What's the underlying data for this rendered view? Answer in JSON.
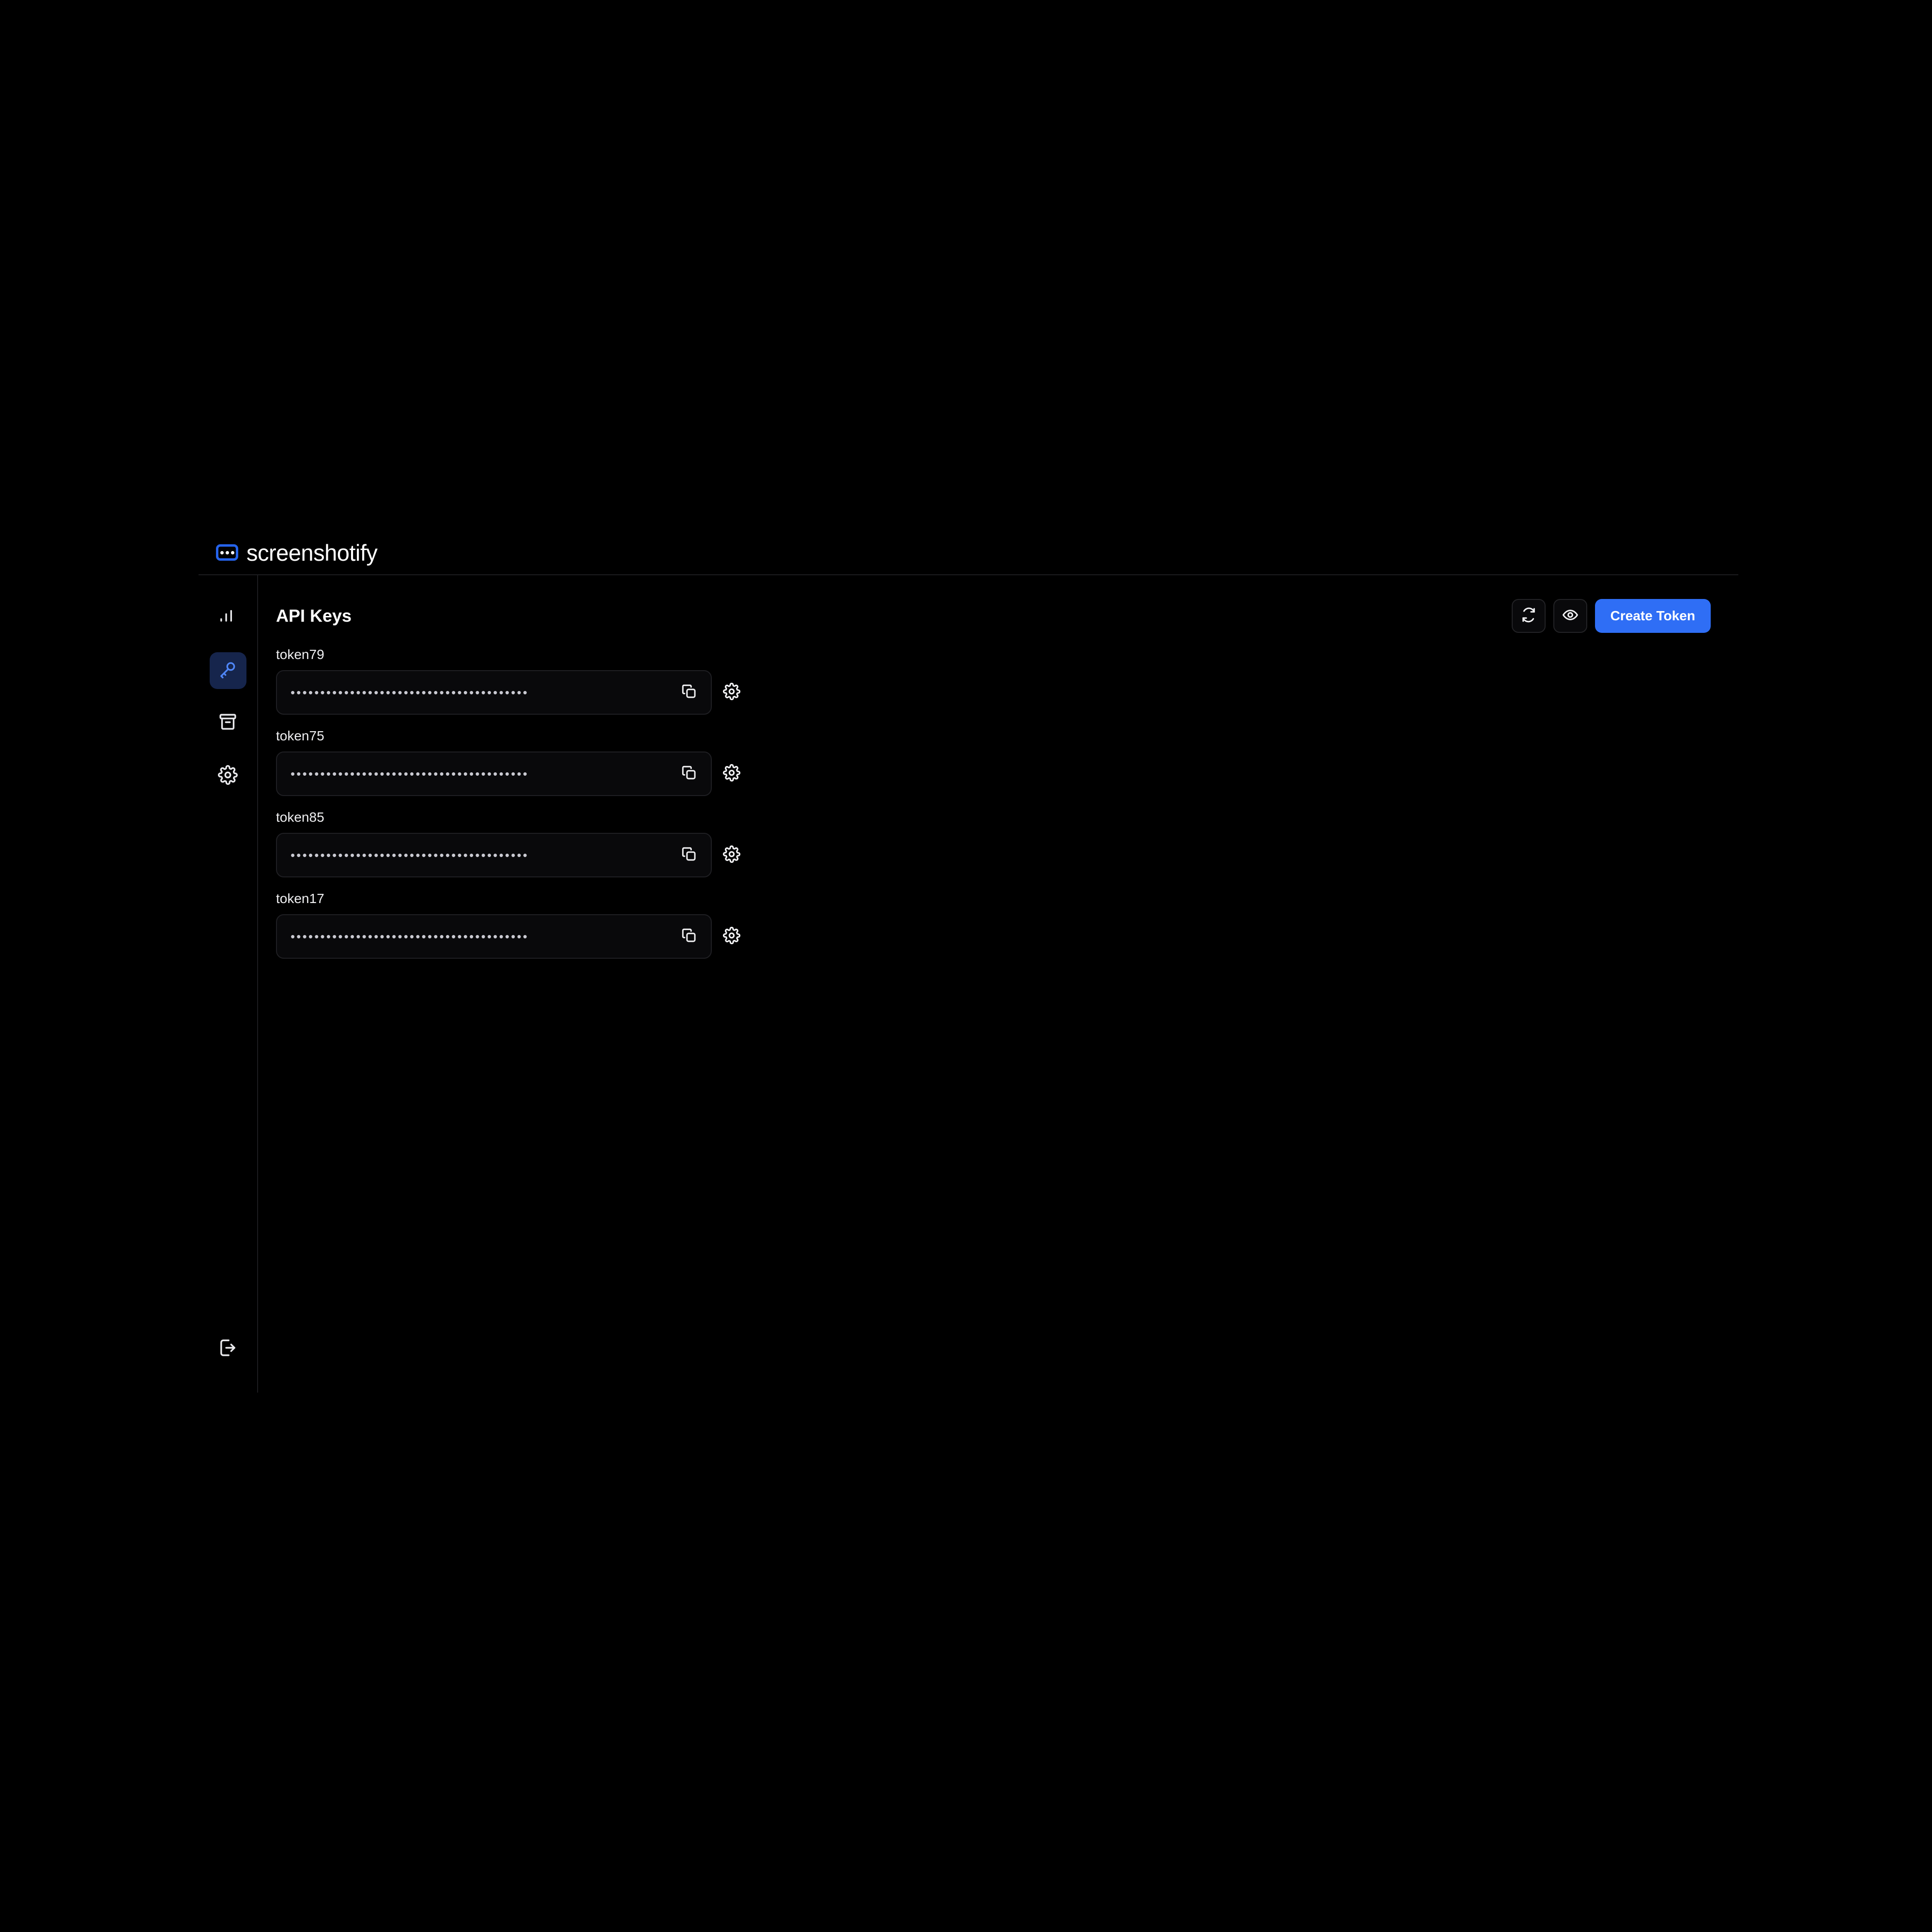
{
  "brand": {
    "name": "screenshotify",
    "logo_icon": "dots-badge-icon"
  },
  "sidebar": {
    "items": [
      {
        "icon": "bar-chart-icon",
        "name": "analytics",
        "active": false
      },
      {
        "icon": "key-icon",
        "name": "api-keys",
        "active": true
      },
      {
        "icon": "archive-icon",
        "name": "archive",
        "active": false
      },
      {
        "icon": "gear-icon",
        "name": "settings",
        "active": false
      }
    ],
    "logout": {
      "icon": "logout-icon",
      "name": "logout"
    }
  },
  "header": {
    "title": "API Keys",
    "refresh_icon": "refresh-icon",
    "reveal_icon": "eye-icon",
    "create_label": "Create Token"
  },
  "tokens": [
    {
      "label": "token79",
      "value": "••••••••••••••••••••••••••••••••••••••••",
      "copy_icon": "copy-icon",
      "settings_icon": "gear-icon"
    },
    {
      "label": "token75",
      "value": "••••••••••••••••••••••••••••••••••••••••",
      "copy_icon": "copy-icon",
      "settings_icon": "gear-icon"
    },
    {
      "label": "token85",
      "value": "••••••••••••••••••••••••••••••••••••••••",
      "copy_icon": "copy-icon",
      "settings_icon": "gear-icon"
    },
    {
      "label": "token17",
      "value": "••••••••••••••••••••••••••••••••••••••••",
      "copy_icon": "copy-icon",
      "settings_icon": "gear-icon"
    }
  ],
  "colors": {
    "background": "#000000",
    "accent": "#2f6ef5",
    "active_nav_bg": "#16254c",
    "active_nav_icon": "#4f86f7",
    "border": "#1c1c1f",
    "text": "#ffffff"
  }
}
